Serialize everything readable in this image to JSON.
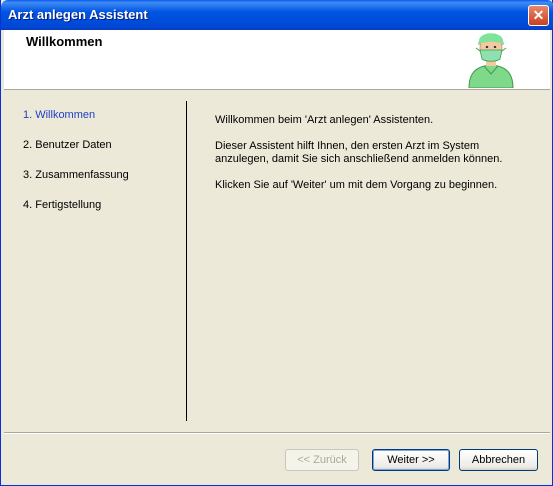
{
  "window": {
    "title": "Arzt anlegen Assistent",
    "close_glyph": "✕"
  },
  "header": {
    "title": "Willkommen",
    "icon": "doctor-icon"
  },
  "steps": [
    {
      "label": "1. Willkommen",
      "active": true
    },
    {
      "label": "2. Benutzer Daten",
      "active": false
    },
    {
      "label": "3. Zusammenfassung",
      "active": false
    },
    {
      "label": "4. Fertigstellung",
      "active": false
    }
  ],
  "content": {
    "intro": "Willkommen beim 'Arzt anlegen' Assistenten.",
    "description": "Dieser Assistent hilft Ihnen, den ersten Arzt im System anzulegen, damit Sie sich anschließend anmelden können.",
    "instruction": "Klicken Sie auf 'Weiter' um mit dem Vorgang zu beginnen."
  },
  "buttons": {
    "back": "<< Zurück",
    "next": "Weiter >>",
    "cancel": "Abbrechen"
  },
  "colors": {
    "active_step": "#1f3fc8",
    "titlebar": "#0054e3",
    "dialog_bg": "#ece9d8"
  }
}
